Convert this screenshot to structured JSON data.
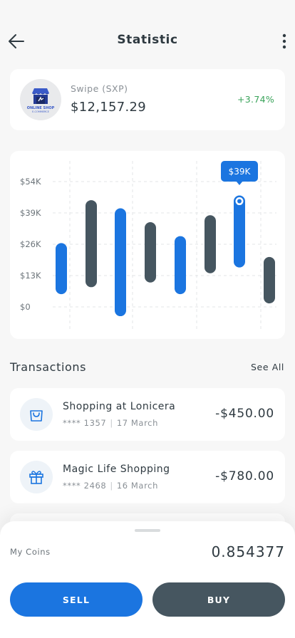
{
  "header": {
    "title": "Statistic",
    "back_icon": "arrow-left-icon",
    "more_icon": "more-vertical-icon"
  },
  "coin": {
    "logo_icon": "online-shop-logo",
    "logo_text": "ONLINE SHOP",
    "logo_sub": "E-COMMERCE",
    "name": "Swipe (SXP)",
    "price": "$12,157.29",
    "change": "+3.74%",
    "change_color": "#3aa35a"
  },
  "chart_data": {
    "type": "candlestick",
    "title": "",
    "xlabel": "",
    "ylabel": "",
    "y_ticks": [
      "$54K",
      "$39K",
      "$26K",
      "$13K",
      "$0"
    ],
    "ylim": [
      0,
      54
    ],
    "unit": "K USD",
    "grid": true,
    "tooltip": {
      "label": "$39K",
      "index": 6
    },
    "series": [
      {
        "color": "#1b75e0",
        "label": "up"
      },
      {
        "color": "#465660",
        "label": "down"
      }
    ],
    "bars": [
      {
        "low": 5.5,
        "high": 27.5,
        "color": "#1b75e0"
      },
      {
        "low": 8.5,
        "high": 46,
        "color": "#465660"
      },
      {
        "low": -4,
        "high": 42.5,
        "color": "#1b75e0"
      },
      {
        "low": 10.5,
        "high": 36.5,
        "color": "#465660"
      },
      {
        "low": 5.5,
        "high": 30.5,
        "color": "#1b75e0"
      },
      {
        "low": 14.5,
        "high": 39.5,
        "color": "#465660"
      },
      {
        "low": 17,
        "high": 48,
        "color": "#1b75e0"
      },
      {
        "low": 1.5,
        "high": 21.5,
        "color": "#465660"
      }
    ]
  },
  "transactions": {
    "title": "Transactions",
    "see_all": "See All",
    "items": [
      {
        "icon": "shopping-bag-icon",
        "name": "Shopping at Lonicera",
        "card": "**** 1357",
        "date": "17 March",
        "amount": "-$450.00"
      },
      {
        "icon": "gift-icon",
        "name": "Magic Life Shopping",
        "card": "**** 2468",
        "date": "16 March",
        "amount": "-$780.00"
      }
    ]
  },
  "wallet": {
    "label": "My Coins",
    "value": "0.854377",
    "sell_label": "SELL",
    "buy_label": "BUY",
    "accent": "#1b75e0",
    "secondary": "#465660"
  }
}
